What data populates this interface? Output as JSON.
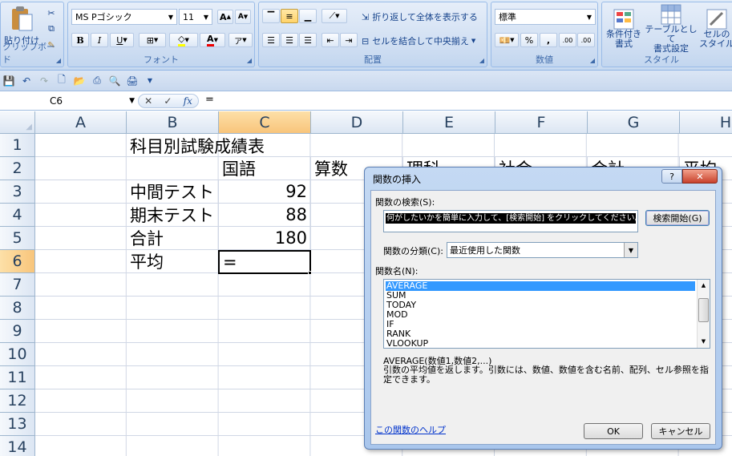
{
  "ribbon": {
    "clipboard": {
      "paste_label": "貼り付け",
      "group_label": "クリップボード"
    },
    "font": {
      "font_name": "MS Pゴシック",
      "font_size": "11",
      "group_label": "フォント",
      "bold": "B",
      "italic": "I",
      "underline": "U",
      "grow": "A",
      "shrink": "A",
      "color_letter": "A"
    },
    "alignment": {
      "wrap_text": "折り返して全体を表示する",
      "merge_center": "セルを結合して中央揃え",
      "group_label": "配置"
    },
    "number": {
      "format": "標準",
      "percent": "%",
      "comma": ",",
      "inc_decimal": ".00",
      "dec_decimal": ".00",
      "group_label": "数値"
    },
    "styles": {
      "conditional": "条件付き\n書式",
      "table": "テーブルとして\n書式設定",
      "cell_styles": "セルの\nスタイル",
      "group_label": "スタイル"
    }
  },
  "formula_bar": {
    "name_box": "C6",
    "fx": "fx",
    "content": "="
  },
  "sheet": {
    "columns": [
      "A",
      "B",
      "C",
      "D",
      "E",
      "F",
      "G",
      "H"
    ],
    "rows": [
      "1",
      "2",
      "3",
      "4",
      "5",
      "6",
      "7",
      "8",
      "9",
      "10",
      "11",
      "12",
      "13",
      "14"
    ],
    "cells": {
      "b1": "科目別試験成績表",
      "c2": "国語",
      "d2": "算数",
      "e2": "理科",
      "f2": "社会",
      "g2": "合計",
      "h2": "平均",
      "b3": "中間テスト",
      "c3": "92",
      "b4": "期末テスト",
      "c4": "88",
      "b5": "合計",
      "c5": "180",
      "b6": "平均",
      "c6": "="
    }
  },
  "dialog": {
    "title": "関数の挿入",
    "help_q": "?",
    "close": "✕",
    "search_label": "関数の検索(S):",
    "search_value": "何がしたいかを簡単に入力して、[検索開始] をクリックしてください。",
    "search_button": "検索開始(G)",
    "category_label": "関数の分類(C):",
    "category_value": "最近使用した関数",
    "names_label": "関数名(N):",
    "functions": [
      "AVERAGE",
      "SUM",
      "TODAY",
      "MOD",
      "IF",
      "RANK",
      "VLOOKUP"
    ],
    "syntax": "AVERAGE(数値1,数値2,...)",
    "description": "引数の平均値を返します。引数には、数値、数値を含む名前、配列、セル参照を指定できます。",
    "help_link": "この関数のヘルプ",
    "ok": "OK",
    "cancel": "キャンセル"
  },
  "colors": {
    "selected_header": "#f8c57b",
    "accent": "#15428b",
    "list_select": "#3399ff"
  }
}
